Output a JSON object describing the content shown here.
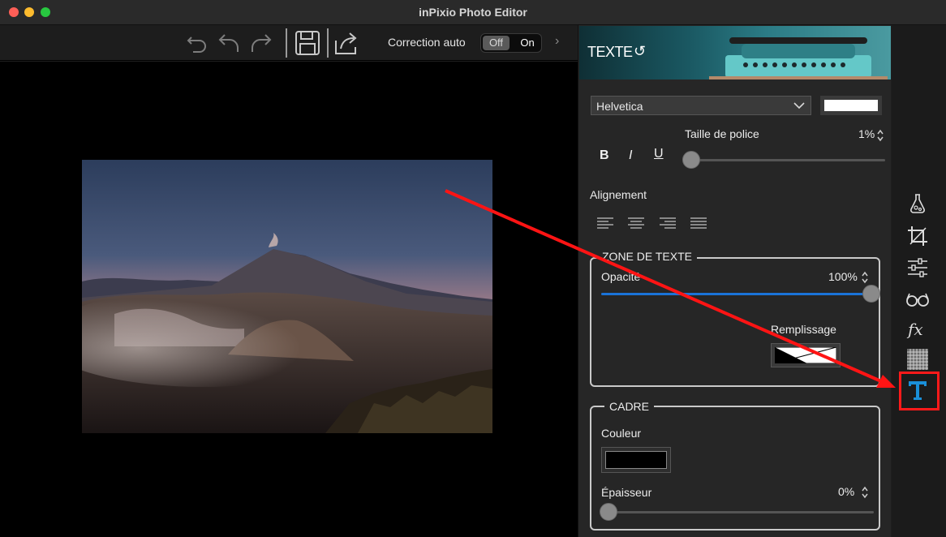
{
  "window": {
    "title": "inPixio Photo Editor"
  },
  "toolbar": {
    "correction_label": "Correction auto",
    "toggle_off": "Off",
    "toggle_on": "On"
  },
  "panel": {
    "title": "TEXTE",
    "font": {
      "value": "Helvetica",
      "color": "#ffffff"
    },
    "font_size": {
      "label": "Taille de police",
      "value": "1%"
    },
    "format": {
      "bold": "B",
      "italic": "I",
      "underline": "U"
    },
    "alignment_label": "Alignement",
    "zone_texte": {
      "title": "ZONE DE TEXTE",
      "opacity_label": "Opacité",
      "opacity_value": "100%",
      "opacity_level": 1.0,
      "fill_label": "Remplissage"
    },
    "cadre": {
      "title": "CADRE",
      "color_label": "Couleur",
      "color": "#000000",
      "thickness_label": "Épaisseur",
      "thickness_value": "0%",
      "thickness_level": 0.0
    }
  },
  "sidebar": {
    "icons": [
      "potion-icon",
      "crop-icon",
      "adjustments-icon",
      "glasses-icon",
      "fx-icon",
      "texture-icon",
      "text-tool-icon"
    ],
    "active": "text-tool-icon",
    "accent_color": "#1a8fd8",
    "highlight_color": "#ff1a1a"
  }
}
